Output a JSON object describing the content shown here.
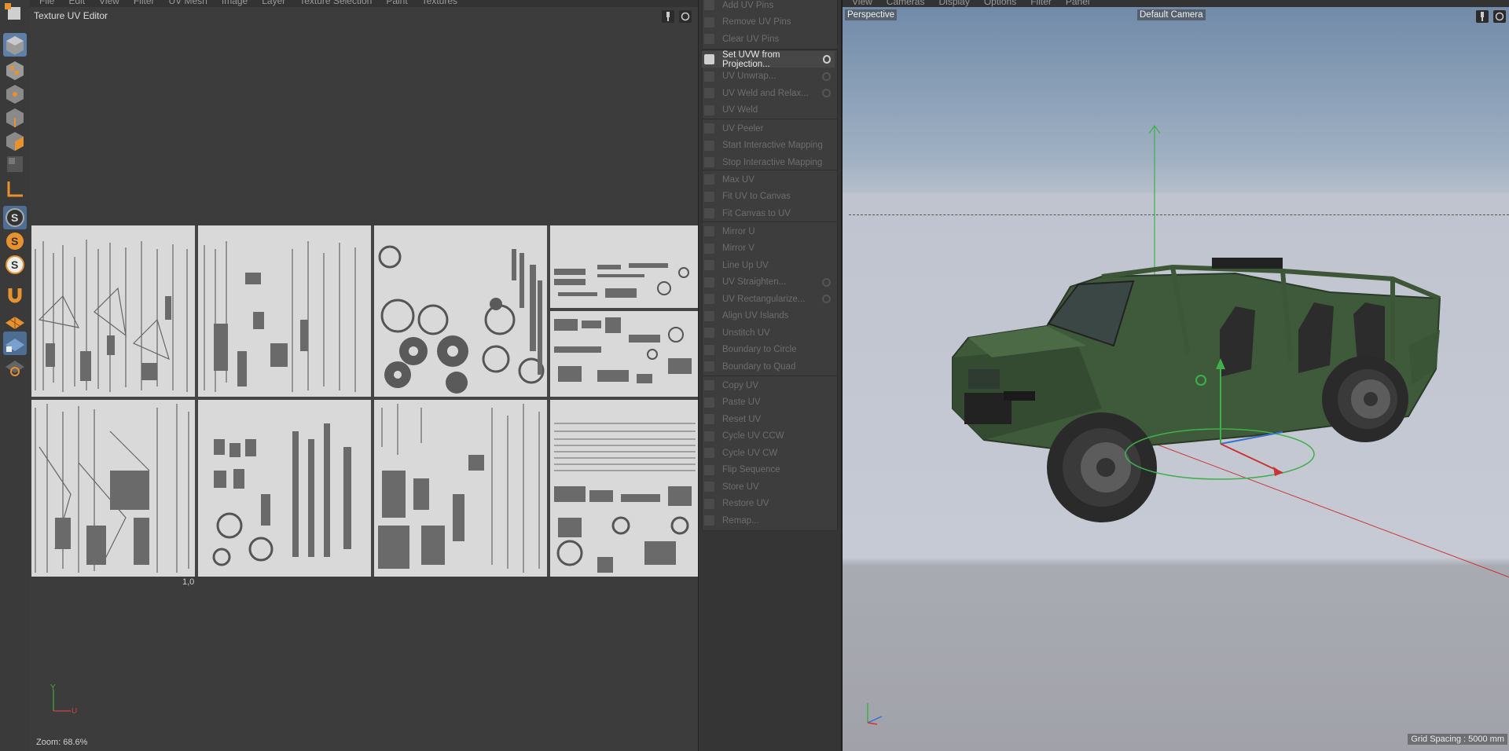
{
  "uv_editor": {
    "menu": [
      "File",
      "Edit",
      "View",
      "Filter",
      "UV Mesh",
      "Image",
      "Layer",
      "Texture Selection",
      "Paint",
      "Textures"
    ],
    "title": "Texture UV Editor",
    "coord_label": "1,0",
    "axis_y": "Y",
    "axis_u": "U",
    "zoom": "Zoom: 68.6%"
  },
  "commands": {
    "groups": [
      [
        "Add UV Pins",
        "Remove UV Pins",
        "Clear UV Pins"
      ],
      [
        "Set UVW from Projection...",
        "UV Unwrap...",
        "UV Weld and Relax...",
        "UV Weld"
      ],
      [
        "UV Peeler",
        "Start Interactive Mapping",
        "Stop Interactive Mapping"
      ],
      [
        "Max UV",
        "Fit UV to Canvas",
        "Fit Canvas to UV"
      ],
      [
        "Mirror U",
        "Mirror V",
        "Line Up UV",
        "UV Straighten...",
        "UV Rectangularize...",
        "Align UV Islands",
        "Unstitch UV",
        "Boundary to Circle",
        "Boundary to Quad"
      ],
      [
        "Copy UV",
        "Paste UV",
        "Reset UV",
        "Cycle UV CCW",
        "Cycle UV CW",
        "Flip Sequence",
        "Store UV",
        "Restore UV",
        "Remap..."
      ]
    ],
    "active": "Set UVW from Projection..."
  },
  "viewport": {
    "menu": [
      "View",
      "Cameras",
      "Display",
      "Options",
      "Filter",
      "Panel"
    ],
    "view_name": "Perspective",
    "camera": "Default Camera",
    "grid_spacing": "Grid Spacing : 5000 mm"
  },
  "colors": {
    "accent_orange": "#e8912f",
    "panel_bg": "#3c3c3c",
    "vehicle_green": "#3f5a3a"
  }
}
